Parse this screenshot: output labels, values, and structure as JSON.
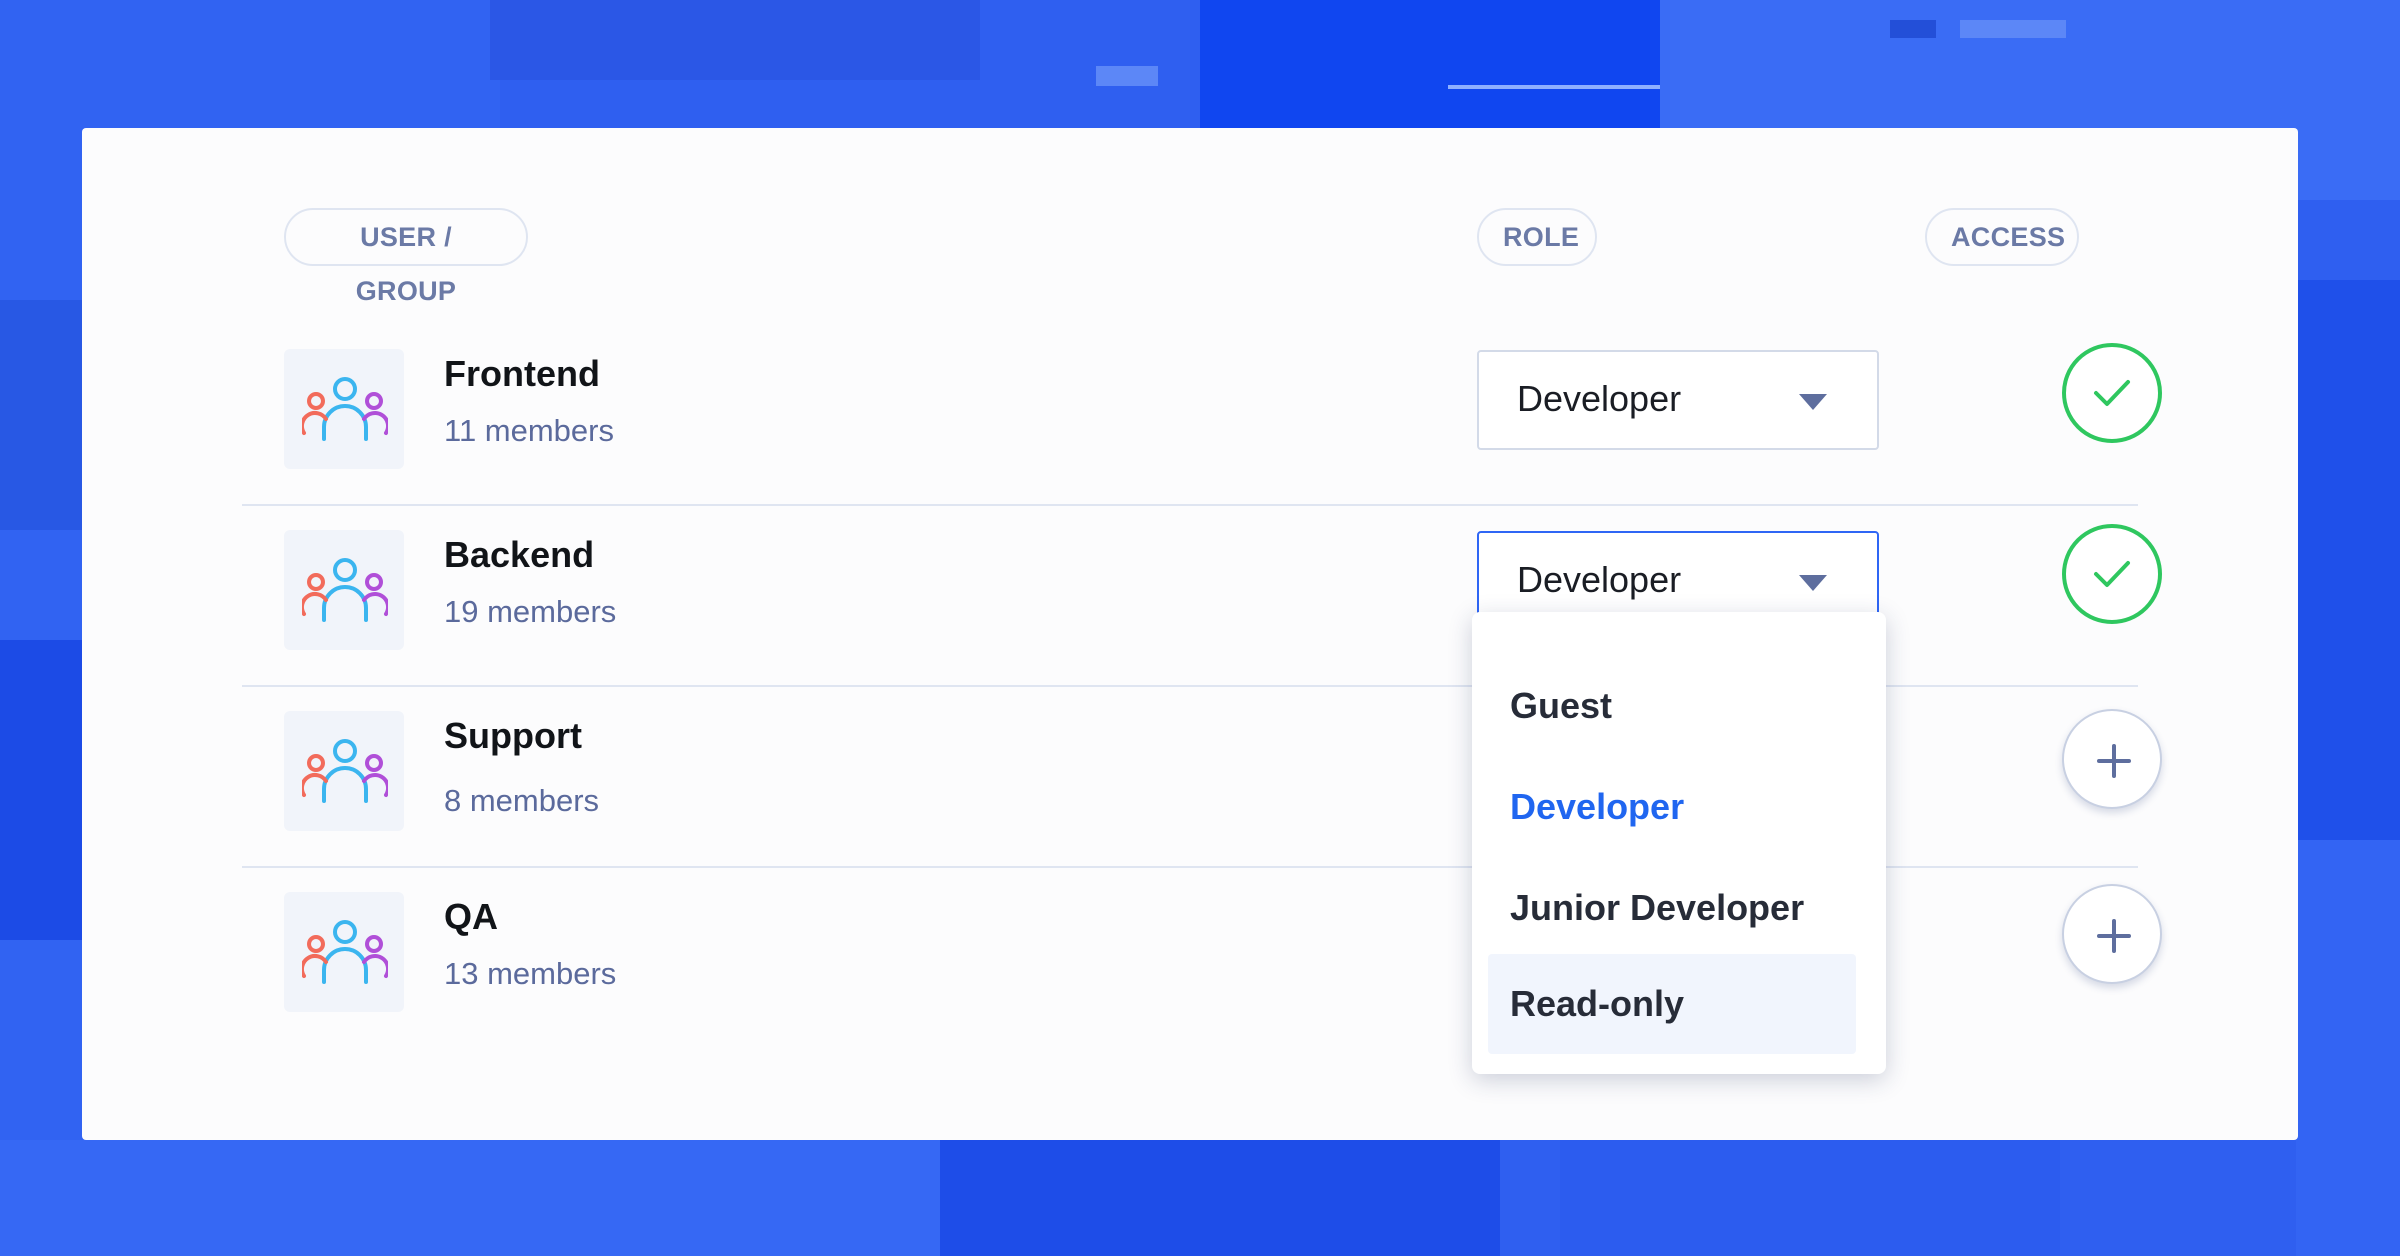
{
  "headers": {
    "user_group": "USER / GROUP",
    "role": "ROLE",
    "access": "ACCESS"
  },
  "rows": [
    {
      "name": "Frontend",
      "members": "11 members",
      "role": "Developer",
      "access": "granted",
      "access_icon": "check-icon"
    },
    {
      "name": "Backend",
      "members": "19  members",
      "role": "Developer",
      "access": "granted",
      "access_icon": "check-icon",
      "dropdown_open": true
    },
    {
      "name": "Support",
      "members": "8  members",
      "role": "",
      "access": "none",
      "access_icon": "plus-icon"
    },
    {
      "name": "QA",
      "members": "13  members",
      "role": "",
      "access": "none",
      "access_icon": "plus-icon"
    }
  ],
  "dropdown": {
    "options": [
      {
        "label": "Guest",
        "state": "default"
      },
      {
        "label": "Developer",
        "state": "selected"
      },
      {
        "label": "Junior Developer",
        "state": "default"
      },
      {
        "label": "Read-only",
        "state": "hovered"
      }
    ]
  },
  "icons": {
    "group_avatar": "users-group-icon",
    "dropdown_caret": "caret-down-icon"
  },
  "colors": {
    "background": "#2f5ff0",
    "card": "#fcfcfd",
    "accent_blue": "#2066f0",
    "access_green": "#2fc75f",
    "muted_text": "#5b6a9c",
    "icon_coral": "#f26b5b",
    "icon_sky": "#3bb5ef",
    "icon_violet": "#b04fd8"
  }
}
